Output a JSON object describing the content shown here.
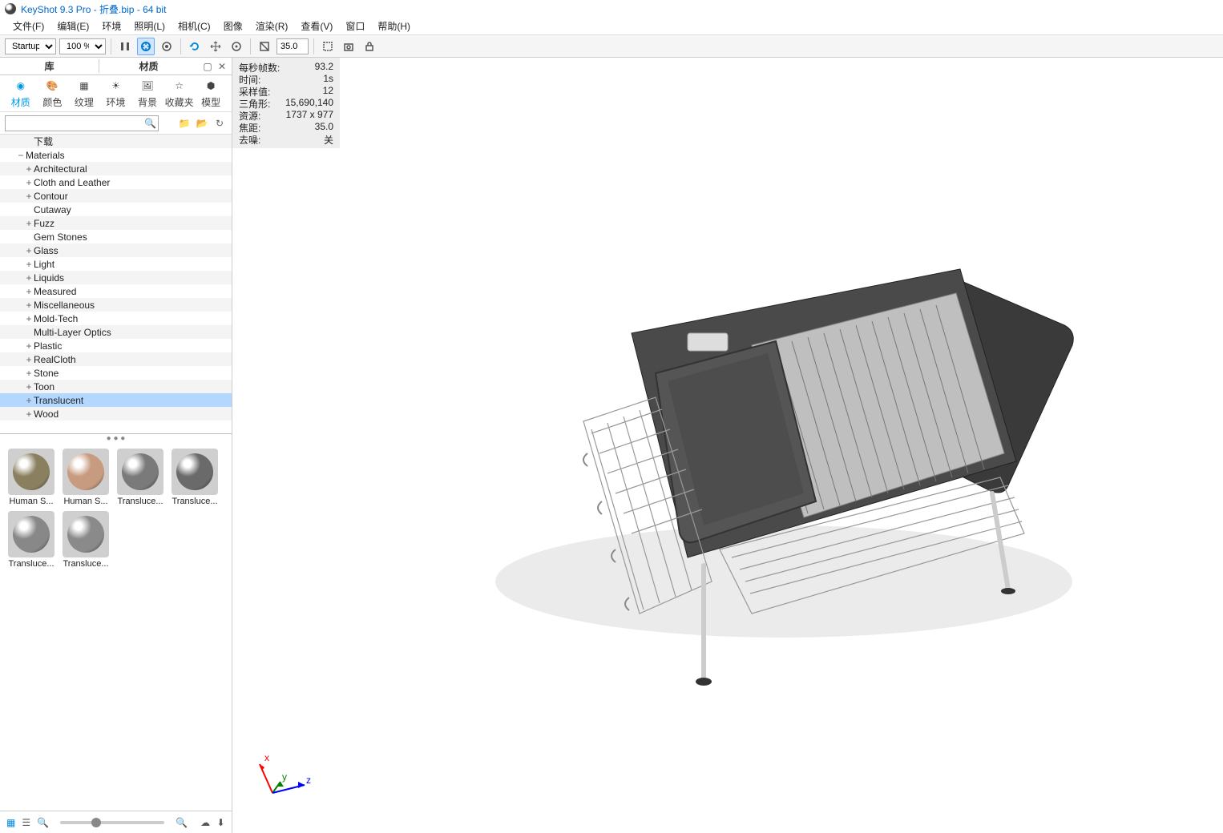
{
  "titlebar": "KeyShot 9.3 Pro  - 折叠.bip  - 64 bit",
  "menu": [
    "文件(F)",
    "编辑(E)",
    "环境",
    "照明(L)",
    "相机(C)",
    "图像",
    "渲染(R)",
    "查看(V)",
    "窗口",
    "帮助(H)"
  ],
  "toolbar": {
    "workspace": "Startup",
    "zoom": "100 %",
    "focal": "35.0"
  },
  "panel": {
    "left_title": "库",
    "right_title": "材质"
  },
  "tabs": [
    {
      "id": "materials",
      "label": "材质",
      "active": true
    },
    {
      "id": "colors",
      "label": "颜色"
    },
    {
      "id": "textures",
      "label": "纹理"
    },
    {
      "id": "environments",
      "label": "环境"
    },
    {
      "id": "backplates",
      "label": "背景"
    },
    {
      "id": "favorites",
      "label": "收藏夹"
    },
    {
      "id": "models",
      "label": "模型"
    }
  ],
  "search_placeholder": "",
  "tree": [
    {
      "label": "下载",
      "level": 1,
      "exp": "",
      "odd": true
    },
    {
      "label": "Materials",
      "level": 0,
      "exp": "−",
      "odd": false
    },
    {
      "label": "Architectural",
      "level": 1,
      "exp": "+",
      "odd": true
    },
    {
      "label": "Cloth and Leather",
      "level": 1,
      "exp": "+",
      "odd": false
    },
    {
      "label": "Contour",
      "level": 1,
      "exp": "+",
      "odd": true
    },
    {
      "label": "Cutaway",
      "level": 1,
      "exp": "",
      "odd": false
    },
    {
      "label": "Fuzz",
      "level": 1,
      "exp": "+",
      "odd": true
    },
    {
      "label": "Gem Stones",
      "level": 1,
      "exp": "",
      "odd": false
    },
    {
      "label": "Glass",
      "level": 1,
      "exp": "+",
      "odd": true
    },
    {
      "label": "Light",
      "level": 1,
      "exp": "+",
      "odd": false
    },
    {
      "label": "Liquids",
      "level": 1,
      "exp": "+",
      "odd": true
    },
    {
      "label": "Measured",
      "level": 1,
      "exp": "+",
      "odd": false
    },
    {
      "label": "Miscellaneous",
      "level": 1,
      "exp": "+",
      "odd": true
    },
    {
      "label": "Mold-Tech",
      "level": 1,
      "exp": "+",
      "odd": false
    },
    {
      "label": "Multi-Layer Optics",
      "level": 1,
      "exp": "",
      "odd": true
    },
    {
      "label": "Plastic",
      "level": 1,
      "exp": "+",
      "odd": false
    },
    {
      "label": "RealCloth",
      "level": 1,
      "exp": "+",
      "odd": true
    },
    {
      "label": "Stone",
      "level": 1,
      "exp": "+",
      "odd": false
    },
    {
      "label": "Toon",
      "level": 1,
      "exp": "+",
      "odd": true
    },
    {
      "label": "Translucent",
      "level": 1,
      "exp": "+",
      "odd": false,
      "selected": true
    },
    {
      "label": "Wood",
      "level": 1,
      "exp": "+",
      "odd": true
    }
  ],
  "thumbs": [
    {
      "label": "Human S...",
      "c": "#8a8060"
    },
    {
      "label": "Human S...",
      "c": "#c79b80"
    },
    {
      "label": "Transluce...",
      "c": "#7a7a7a"
    },
    {
      "label": "Transluce...",
      "c": "#6a6a6a"
    },
    {
      "label": "Transluce...",
      "c": "#888"
    },
    {
      "label": "Transluce...",
      "c": "#8a8a8a"
    }
  ],
  "stats": [
    {
      "k": "每秒帧数:",
      "v": "93.2"
    },
    {
      "k": "时间:",
      "v": "1s"
    },
    {
      "k": "采样值:",
      "v": "12"
    },
    {
      "k": "三角形:",
      "v": "15,690,140"
    },
    {
      "k": "资源:",
      "v": "1737 x 977"
    },
    {
      "k": "焦距:",
      "v": "35.0"
    },
    {
      "k": "去噪:",
      "v": "关"
    }
  ],
  "axes": {
    "x": "x",
    "y": "y",
    "z": "z"
  }
}
